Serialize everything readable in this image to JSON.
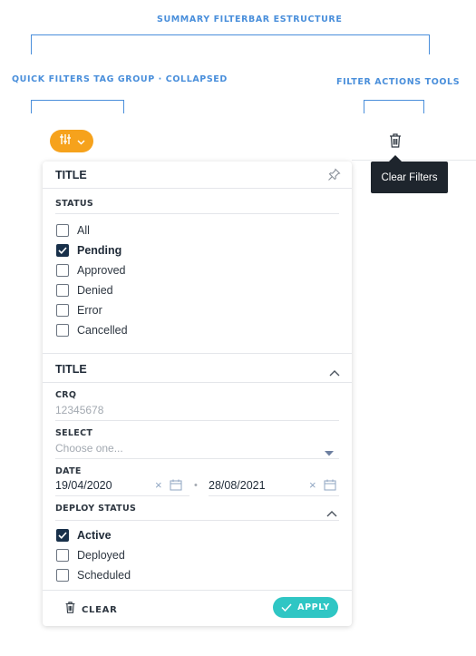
{
  "annotations": {
    "structure": "SUMMARY FILTERBAR ESTRUCTURE",
    "quick_filters": "QUICK FILTERS TAG GROUP · COLLAPSED",
    "actions": "FILTER ACTIONS TOOLS"
  },
  "tooltip": "Clear Filters",
  "section1": {
    "title": "TITLE",
    "status_label": "STATUS",
    "options": [
      {
        "label": "All",
        "checked": false
      },
      {
        "label": "Pending",
        "checked": true
      },
      {
        "label": "Approved",
        "checked": false
      },
      {
        "label": "Denied",
        "checked": false
      },
      {
        "label": "Error",
        "checked": false
      },
      {
        "label": "Cancelled",
        "checked": false
      }
    ]
  },
  "section2": {
    "title": "TITLE",
    "crq_label": "CRQ",
    "crq_placeholder": "12345678",
    "select_label": "SELECT",
    "select_placeholder": "Choose one...",
    "date_label": "DATE",
    "date_from": "19/04/2020",
    "date_to": "28/08/2021",
    "deploy_label": "DEPLOY STATUS",
    "deploy_options": [
      {
        "label": "Active",
        "checked": true
      },
      {
        "label": "Deployed",
        "checked": false
      },
      {
        "label": "Scheduled",
        "checked": false
      }
    ]
  },
  "footer": {
    "clear": "CLEAR",
    "apply": "APPLY"
  },
  "colors": {
    "annotation": "#4a8fdb",
    "filter_button": "#f6a21c",
    "apply_button": "#2fc6c4",
    "checkbox_checked": "#18304a",
    "tooltip_bg": "#1e252d"
  }
}
